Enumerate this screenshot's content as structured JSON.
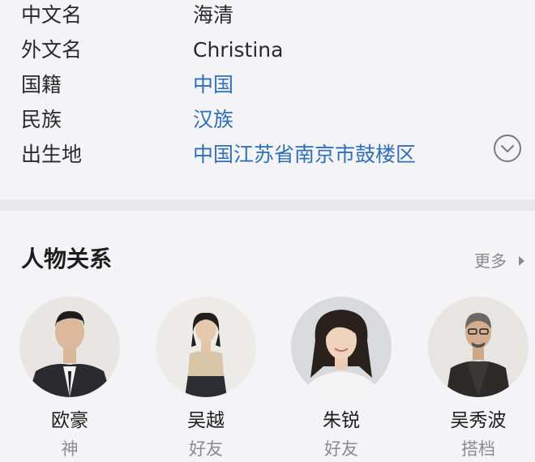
{
  "basic_info": [
    {
      "label": "中文名",
      "value": "海清",
      "is_link": false
    },
    {
      "label": "外文名",
      "value": "Christina",
      "is_link": false
    },
    {
      "label": "国籍",
      "value": "中国",
      "is_link": true
    },
    {
      "label": "民族",
      "value": "汉族",
      "is_link": true
    },
    {
      "label": "出生地",
      "value": "中国江苏省南京市鼓楼区",
      "is_link": true
    }
  ],
  "expand_icon": "chevron-down-circle-icon",
  "relations": {
    "title": "人物关系",
    "more_label": "更多",
    "more_icon": "triangle-right-icon",
    "people": [
      {
        "name": "欧豪",
        "relation": "神"
      },
      {
        "name": "吴越",
        "relation": "好友"
      },
      {
        "name": "朱锐",
        "relation": "好友"
      },
      {
        "name": "吴秀波",
        "relation": "搭档"
      }
    ]
  },
  "colors": {
    "link": "#2f6fb8",
    "background": "#f4f4f6",
    "muted": "#8c8c8c"
  }
}
